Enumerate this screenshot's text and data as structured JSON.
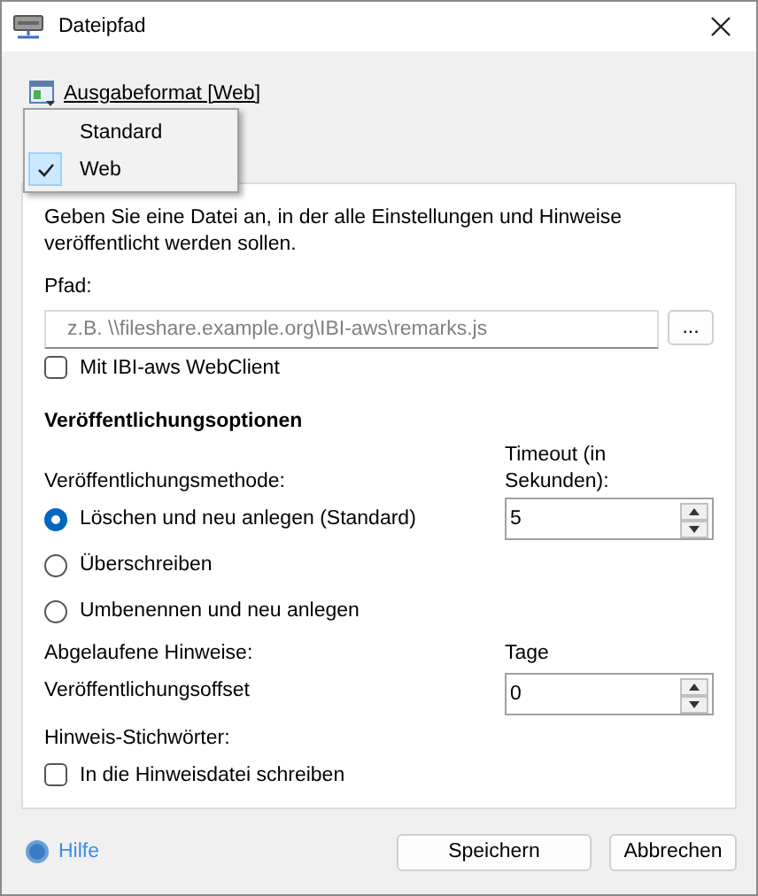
{
  "window": {
    "title": "Dateipfad"
  },
  "format_link": {
    "label": "Ausgabeformat [Web]"
  },
  "format_menu": {
    "items": [
      {
        "label": "Standard",
        "selected": false
      },
      {
        "label": "Web",
        "selected": true
      }
    ]
  },
  "description": "Geben Sie eine Datei an, in der alle Einstellungen und Hinweise veröffentlicht werden sollen.",
  "path": {
    "label": "Pfad:",
    "placeholder": "z.B. \\\\fileshare.example.org\\IBI-aws\\remarks.js",
    "browse_button": "..."
  },
  "webclient": {
    "label": "Mit IBI-aws WebClient",
    "checked": false
  },
  "options_heading": "Veröffentlichungsoptionen",
  "method_label": "Veröffentlichungsmethode:",
  "methods": [
    {
      "label": "Löschen und neu anlegen (Standard)",
      "selected": true
    },
    {
      "label": "Überschreiben",
      "selected": false
    },
    {
      "label": "Umbenennen und neu anlegen",
      "selected": false
    }
  ],
  "timeout": {
    "label": "Timeout (in Sekunden):",
    "value": "5"
  },
  "expired_label": "Abgelaufene Hinweise:",
  "days_label": "Tage",
  "offset": {
    "label": "Veröffentlichungsoffset",
    "value": "0"
  },
  "keywords_label": "Hinweis-Stichwörter:",
  "keywords_checkbox": {
    "label": "In die Hinweisdatei schreiben",
    "checked": false
  },
  "help_link": "Hilfe",
  "buttons": [
    {
      "label": "Speichern"
    },
    {
      "label": "Abbrechen"
    }
  ]
}
